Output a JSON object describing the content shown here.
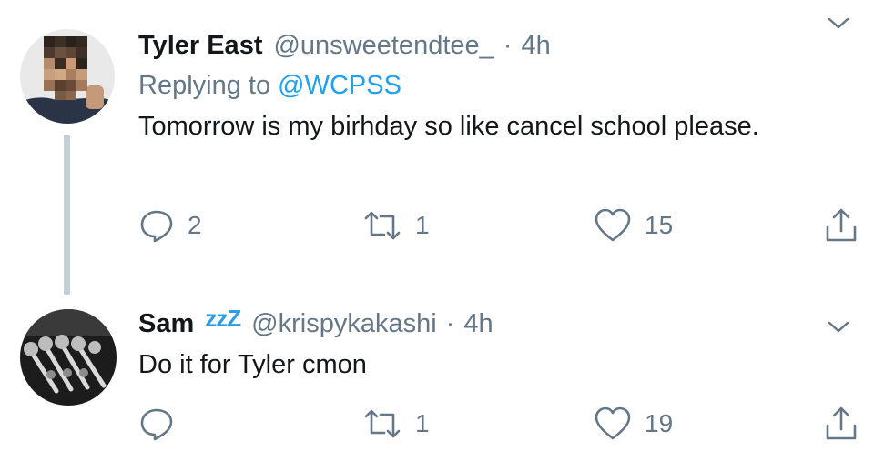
{
  "tweets": [
    {
      "name": "Tyler East",
      "handle": "@unsweetendtee_",
      "dot": "·",
      "time": "4h",
      "replying_prefix": "Replying to",
      "replying_to": "@WCPSS",
      "text": "Tomorrow is my birhday so like cancel school please.",
      "actions": {
        "replies": "2",
        "retweets": "1",
        "likes": "15"
      },
      "icons": [
        "reply-icon",
        "retweet-icon",
        "like-icon",
        "share-icon",
        "chevron-down-icon"
      ]
    },
    {
      "name": "Sam",
      "name_emoji": "zzZ",
      "handle": "@krispykakashi",
      "dot": "·",
      "time": "4h",
      "text": "Do it for Tyler cmon",
      "actions": {
        "replies": "",
        "retweets": "1",
        "likes": "19"
      },
      "icons": [
        "reply-icon",
        "retweet-icon",
        "like-icon",
        "share-icon",
        "chevron-down-icon"
      ]
    }
  ],
  "colors": {
    "text": "#14171a",
    "muted": "#657786",
    "link": "#1da1f2",
    "thread_line": "#c4cfd6"
  }
}
